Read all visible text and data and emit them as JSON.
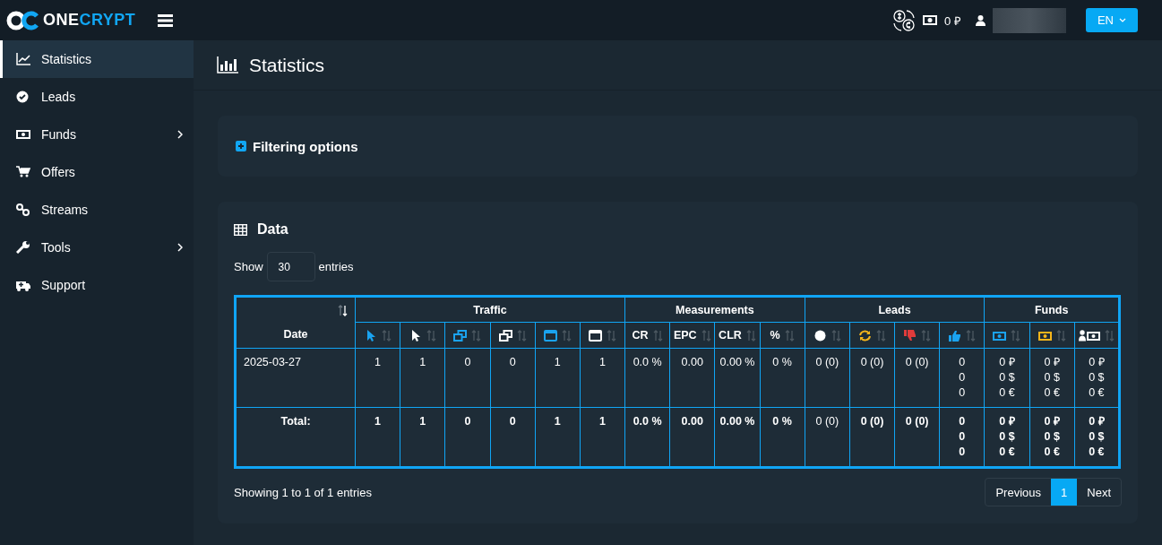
{
  "topbar": {
    "logo": {
      "first": "ONE",
      "second": "CRYPT"
    },
    "balance": "0 ₽",
    "language": "EN"
  },
  "sidebar": {
    "items": [
      {
        "label": "Statistics",
        "selected": true,
        "has_submenu": false
      },
      {
        "label": "Leads",
        "selected": false,
        "has_submenu": false
      },
      {
        "label": "Funds",
        "selected": false,
        "has_submenu": true
      },
      {
        "label": "Offers",
        "selected": false,
        "has_submenu": false
      },
      {
        "label": "Streams",
        "selected": false,
        "has_submenu": false
      },
      {
        "label": "Tools",
        "selected": false,
        "has_submenu": true
      },
      {
        "label": "Support",
        "selected": false,
        "has_submenu": false
      }
    ]
  },
  "page": {
    "title": "Statistics"
  },
  "filter": {
    "title": "Filtering options",
    "expanded": false
  },
  "data": {
    "title": "Data",
    "show_label": "Show",
    "page_size": "30",
    "entries_label": "entries",
    "table": {
      "date_column": {
        "label": "Date",
        "sorted": true
      },
      "groups": [
        {
          "label": "Traffic",
          "columns": [
            {
              "kind": "icon",
              "sorted": false
            },
            {
              "kind": "icon",
              "sorted": false
            },
            {
              "kind": "icon",
              "sorted": false
            },
            {
              "kind": "icon",
              "sorted": false
            },
            {
              "kind": "icon",
              "sorted": false
            },
            {
              "kind": "icon",
              "sorted": false
            }
          ]
        },
        {
          "label": "Measurements",
          "columns": [
            {
              "kind": "text",
              "label": "CR",
              "sorted": false
            },
            {
              "kind": "text",
              "label": "EPC",
              "sorted": false
            },
            {
              "kind": "text",
              "label": "CLR",
              "sorted": false
            },
            {
              "kind": "text",
              "label": "%",
              "sorted": false
            }
          ]
        },
        {
          "label": "Leads",
          "columns": [
            {
              "kind": "icon",
              "sorted": false
            },
            {
              "kind": "icon",
              "sorted": false
            },
            {
              "kind": "icon",
              "sorted": false
            },
            {
              "kind": "icon",
              "sorted": false
            }
          ]
        },
        {
          "label": "Funds",
          "columns": [
            {
              "kind": "icon",
              "sorted": false
            },
            {
              "kind": "icon",
              "sorted": false
            },
            {
              "kind": "icon",
              "sorted": false
            }
          ]
        }
      ],
      "rows": [
        {
          "kind": "data",
          "cells": [
            {
              "lines": [
                "2025-03-27"
              ],
              "bold": false
            },
            {
              "lines": [
                "1"
              ],
              "bold": false
            },
            {
              "lines": [
                "1"
              ],
              "bold": false
            },
            {
              "lines": [
                "0"
              ],
              "bold": false
            },
            {
              "lines": [
                "0"
              ],
              "bold": false
            },
            {
              "lines": [
                "1"
              ],
              "bold": false
            },
            {
              "lines": [
                "1"
              ],
              "bold": false
            },
            {
              "lines": [
                "0.0 %"
              ],
              "bold": false
            },
            {
              "lines": [
                "0.00"
              ],
              "bold": false
            },
            {
              "lines": [
                "0.00 %"
              ],
              "bold": false
            },
            {
              "lines": [
                "0 %"
              ],
              "bold": false
            },
            {
              "lines": [
                "0 (0)"
              ],
              "bold": false
            },
            {
              "lines": [
                "0 (0)"
              ],
              "bold": false
            },
            {
              "lines": [
                "0 (0)"
              ],
              "bold": false
            },
            {
              "lines": [
                "0",
                "0",
                "0"
              ],
              "bold": false
            },
            {
              "lines": [
                "0 ₽",
                "0 $",
                "0 €"
              ],
              "bold": false
            },
            {
              "lines": [
                "0 ₽",
                "0 $",
                "0 €"
              ],
              "bold": false
            },
            {
              "lines": [
                "0 ₽",
                "0 $",
                "0 €"
              ],
              "bold": false
            }
          ]
        },
        {
          "kind": "total",
          "cells": [
            {
              "lines": [
                "Total:"
              ],
              "bold": true
            },
            {
              "lines": [
                "1"
              ],
              "bold": true
            },
            {
              "lines": [
                "1"
              ],
              "bold": true
            },
            {
              "lines": [
                "0"
              ],
              "bold": true
            },
            {
              "lines": [
                "0"
              ],
              "bold": true
            },
            {
              "lines": [
                "1"
              ],
              "bold": true
            },
            {
              "lines": [
                "1"
              ],
              "bold": true
            },
            {
              "lines": [
                "0.0 %"
              ],
              "bold": true
            },
            {
              "lines": [
                "0.00"
              ],
              "bold": true
            },
            {
              "lines": [
                "0.00 %"
              ],
              "bold": true
            },
            {
              "lines": [
                "0 %"
              ],
              "bold": true
            },
            {
              "lines": [
                "0 (0)"
              ],
              "bold": false
            },
            {
              "lines": [
                "0 (0)"
              ],
              "bold": true
            },
            {
              "lines": [
                "0 (0)"
              ],
              "bold": true
            },
            {
              "lines": [
                "0",
                "0",
                "0"
              ],
              "bold": true
            },
            {
              "lines": [
                "0 ₽",
                "0 $",
                "0 €"
              ],
              "bold": true
            },
            {
              "lines": [
                "0 ₽",
                "0 $",
                "0 €"
              ],
              "bold": true
            },
            {
              "lines": [
                "0 ₽",
                "0 $",
                "0 €"
              ],
              "bold": true
            }
          ]
        }
      ]
    },
    "summary": "Showing 1 to 1 of 1 entries",
    "pagination": [
      {
        "label": "Previous",
        "selected": false
      },
      {
        "label": "1",
        "selected": true
      },
      {
        "label": "Next",
        "selected": false
      }
    ]
  }
}
